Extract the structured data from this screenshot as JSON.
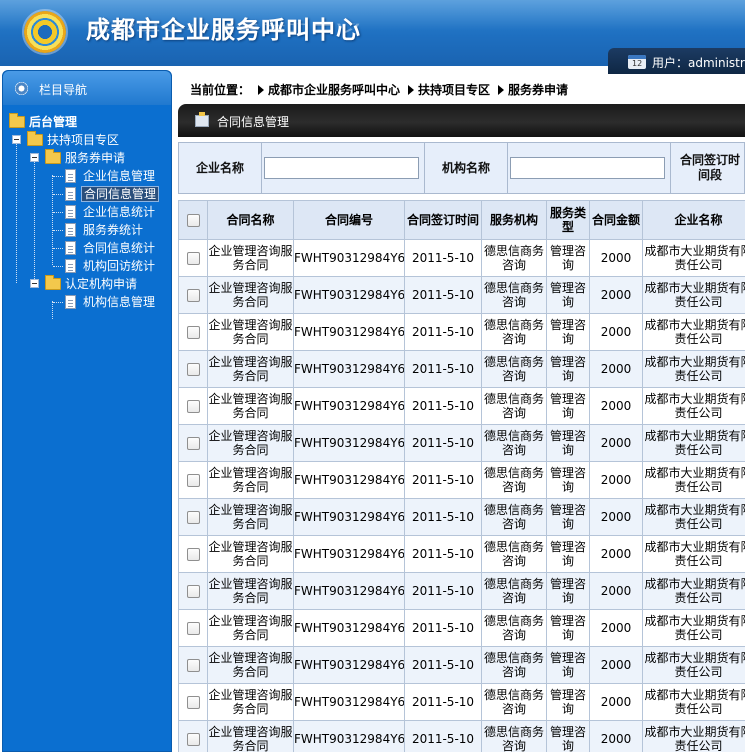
{
  "header": {
    "site_title": "成都市企业服务呼叫中心",
    "user_label": "用户：administrator"
  },
  "sidebar": {
    "title": "栏目导航",
    "tree": [
      {
        "label": "后台管理",
        "level": 0,
        "kind": "root"
      },
      {
        "label": "扶持项目专区",
        "level": 1,
        "kind": "folder"
      },
      {
        "label": "服务券申请",
        "level": 2,
        "kind": "folder"
      },
      {
        "label": "企业信息管理",
        "level": 3,
        "kind": "page"
      },
      {
        "label": "合同信息管理",
        "level": 3,
        "kind": "page",
        "selected": true
      },
      {
        "label": "企业信息统计",
        "level": 3,
        "kind": "page"
      },
      {
        "label": "服务券统计",
        "level": 3,
        "kind": "page"
      },
      {
        "label": "合同信息统计",
        "level": 3,
        "kind": "page"
      },
      {
        "label": "机构回访统计",
        "level": 3,
        "kind": "page"
      },
      {
        "label": "认定机构申请",
        "level": 2,
        "kind": "folder"
      },
      {
        "label": "机构信息管理",
        "level": 3,
        "kind": "page"
      }
    ]
  },
  "breadcrumb": {
    "prefix": "当前位置：",
    "items": [
      "成都市企业服务呼叫中心",
      "扶持项目专区",
      "服务券申请"
    ]
  },
  "section": {
    "title": "合同信息管理"
  },
  "search": {
    "company_label": "企业名称",
    "company_value": "",
    "agency_label": "机构名称",
    "agency_value": "",
    "date_label": "合同签订时间段"
  },
  "table": {
    "headers": [
      "合同名称",
      "合同编号",
      "合同签订时间",
      "服务机构",
      "服务类型",
      "合同金额",
      "企业名称"
    ],
    "rows": [
      [
        "企业管理咨询服务合同",
        "FWHT90312984Y6",
        "2011-5-10",
        "德思信商务咨询",
        "管理咨询",
        "2000",
        "成都市大业期货有限责任公司"
      ],
      [
        "企业管理咨询服务合同",
        "FWHT90312984Y6",
        "2011-5-10",
        "德思信商务咨询",
        "管理咨询",
        "2000",
        "成都市大业期货有限责任公司"
      ],
      [
        "企业管理咨询服务合同",
        "FWHT90312984Y6",
        "2011-5-10",
        "德思信商务咨询",
        "管理咨询",
        "2000",
        "成都市大业期货有限责任公司"
      ],
      [
        "企业管理咨询服务合同",
        "FWHT90312984Y6",
        "2011-5-10",
        "德思信商务咨询",
        "管理咨询",
        "2000",
        "成都市大业期货有限责任公司"
      ],
      [
        "企业管理咨询服务合同",
        "FWHT90312984Y6",
        "2011-5-10",
        "德思信商务咨询",
        "管理咨询",
        "2000",
        "成都市大业期货有限责任公司"
      ],
      [
        "企业管理咨询服务合同",
        "FWHT90312984Y6",
        "2011-5-10",
        "德思信商务咨询",
        "管理咨询",
        "2000",
        "成都市大业期货有限责任公司"
      ],
      [
        "企业管理咨询服务合同",
        "FWHT90312984Y6",
        "2011-5-10",
        "德思信商务咨询",
        "管理咨询",
        "2000",
        "成都市大业期货有限责任公司"
      ],
      [
        "企业管理咨询服务合同",
        "FWHT90312984Y6",
        "2011-5-10",
        "德思信商务咨询",
        "管理咨询",
        "2000",
        "成都市大业期货有限责任公司"
      ],
      [
        "企业管理咨询服务合同",
        "FWHT90312984Y6",
        "2011-5-10",
        "德思信商务咨询",
        "管理咨询",
        "2000",
        "成都市大业期货有限责任公司"
      ],
      [
        "企业管理咨询服务合同",
        "FWHT90312984Y6",
        "2011-5-10",
        "德思信商务咨询",
        "管理咨询",
        "2000",
        "成都市大业期货有限责任公司"
      ],
      [
        "企业管理咨询服务合同",
        "FWHT90312984Y6",
        "2011-5-10",
        "德思信商务咨询",
        "管理咨询",
        "2000",
        "成都市大业期货有限责任公司"
      ],
      [
        "企业管理咨询服务合同",
        "FWHT90312984Y6",
        "2011-5-10",
        "德思信商务咨询",
        "管理咨询",
        "2000",
        "成都市大业期货有限责任公司"
      ],
      [
        "企业管理咨询服务合同",
        "FWHT90312984Y6",
        "2011-5-10",
        "德思信商务咨询",
        "管理咨询",
        "2000",
        "成都市大业期货有限责任公司"
      ],
      [
        "企业管理咨询服务合同",
        "FWHT90312984Y6",
        "2011-5-10",
        "德思信商务咨询",
        "管理咨询",
        "2000",
        "成都市大业期货有限责任公司"
      ]
    ]
  }
}
